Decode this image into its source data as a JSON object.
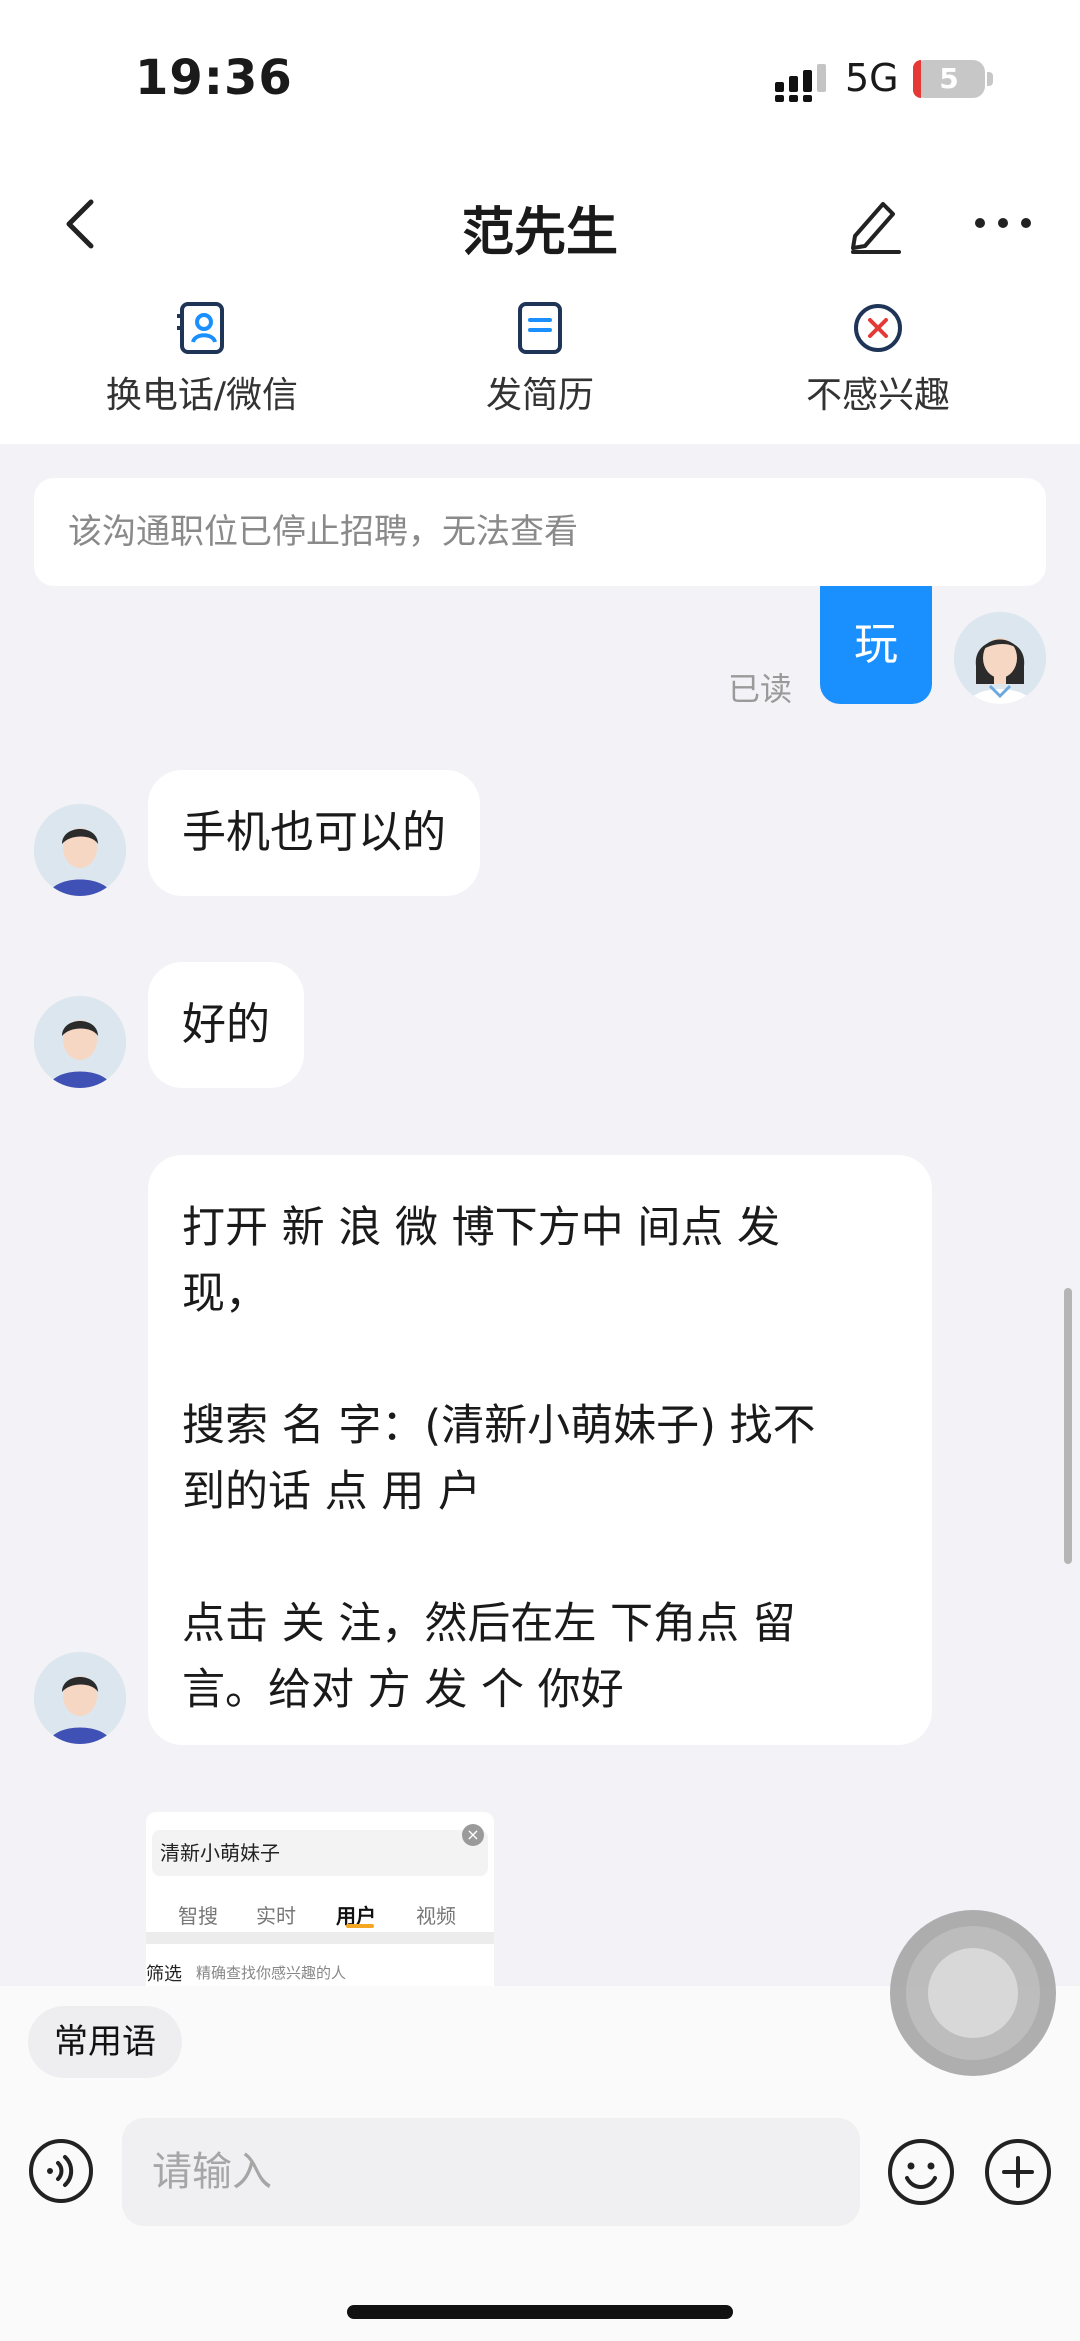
{
  "status_bar": {
    "time": "19:36",
    "network": "5G",
    "battery": "5"
  },
  "header": {
    "title": "范先生"
  },
  "actions": [
    {
      "label": "换电话/微信",
      "icon": "contact-card-icon"
    },
    {
      "label": "发简历",
      "icon": "resume-icon"
    },
    {
      "label": "不感兴趣",
      "icon": "not-interested-icon"
    }
  ],
  "notice": "该沟通职位已停止招聘，无法查看",
  "messages": {
    "mine_text": "玩",
    "read_status": "已读",
    "reply1": "手机也可以的",
    "reply2": "好的",
    "long_lines": [
      "打开 新 浪 微  博下方中 间点 发",
      "现，",
      "",
      "搜索 名  字：(清新小萌妹子) 找不",
      "到的话 点 用 户",
      "",
      "点击 关 注，然后在左 下角点 留",
      "言。给对 方 发 个 你好"
    ],
    "image": {
      "search_text": "清新小萌妹子",
      "tabs": [
        "智搜",
        "实时",
        "用户",
        "视频"
      ],
      "active_tab": "用户",
      "filter_label": "筛选",
      "filter_hint": "精确查找你感兴趣的人"
    }
  },
  "composer": {
    "phrases_label": "常用语",
    "input_placeholder": "请输入"
  },
  "colors": {
    "accent": "#1a90ff",
    "background": "#f2f2f7"
  }
}
